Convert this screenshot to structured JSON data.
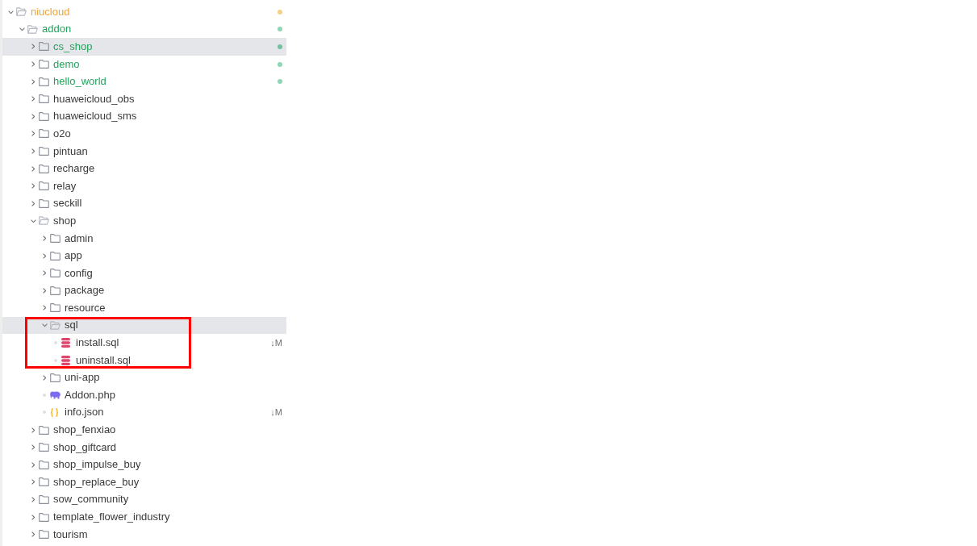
{
  "tree": [
    {
      "name": "niucloud",
      "kind": "folder",
      "expanded": true,
      "selected": false,
      "annotated": false,
      "modified": true,
      "untracked": false,
      "color": "#f5cf86",
      "children": [
        {
          "name": "addon",
          "kind": "folder",
          "expanded": true,
          "selected": false,
          "annotated": false,
          "modified": false,
          "untracked": true,
          "color": "#8fd6b5",
          "children": [
            {
              "name": "cs_shop",
              "kind": "folder",
              "expanded": false,
              "selected": true,
              "annotated": false,
              "modified": false,
              "untracked": true,
              "color": "#74c29d"
            },
            {
              "name": "demo",
              "kind": "folder",
              "expanded": false,
              "selected": false,
              "annotated": false,
              "modified": false,
              "untracked": true,
              "color": "#8fd6b5"
            },
            {
              "name": "hello_world",
              "kind": "folder",
              "expanded": false,
              "selected": false,
              "annotated": false,
              "modified": false,
              "untracked": true,
              "color": "#8fd6b5"
            },
            {
              "name": "huaweicloud_obs",
              "kind": "folder",
              "expanded": false,
              "selected": false,
              "annotated": false,
              "modified": false,
              "untracked": false
            },
            {
              "name": "huaweicloud_sms",
              "kind": "folder",
              "expanded": false,
              "selected": false,
              "annotated": false,
              "modified": false,
              "untracked": false
            },
            {
              "name": "o2o",
              "kind": "folder",
              "expanded": false,
              "selected": false,
              "annotated": false,
              "modified": false,
              "untracked": false
            },
            {
              "name": "pintuan",
              "kind": "folder",
              "expanded": false,
              "selected": false,
              "annotated": false,
              "modified": false,
              "untracked": false
            },
            {
              "name": "recharge",
              "kind": "folder",
              "expanded": false,
              "selected": false,
              "annotated": false,
              "modified": false,
              "untracked": false
            },
            {
              "name": "relay",
              "kind": "folder",
              "expanded": false,
              "selected": false,
              "annotated": false,
              "modified": false,
              "untracked": false
            },
            {
              "name": "seckill",
              "kind": "folder",
              "expanded": false,
              "selected": false,
              "annotated": false,
              "modified": false,
              "untracked": false
            },
            {
              "name": "shop",
              "kind": "folder",
              "expanded": true,
              "selected": false,
              "annotated": false,
              "modified": false,
              "untracked": false,
              "children": [
                {
                  "name": "admin",
                  "kind": "folder",
                  "expanded": false,
                  "selected": false,
                  "annotated": false,
                  "modified": false,
                  "untracked": false
                },
                {
                  "name": "app",
                  "kind": "folder",
                  "expanded": false,
                  "selected": false,
                  "annotated": false,
                  "modified": false,
                  "untracked": false
                },
                {
                  "name": "config",
                  "kind": "folder",
                  "expanded": false,
                  "selected": false,
                  "annotated": false,
                  "modified": false,
                  "untracked": false
                },
                {
                  "name": "package",
                  "kind": "folder",
                  "expanded": false,
                  "selected": false,
                  "annotated": false,
                  "modified": false,
                  "untracked": false
                },
                {
                  "name": "resource",
                  "kind": "folder",
                  "expanded": false,
                  "selected": false,
                  "annotated": false,
                  "modified": false,
                  "untracked": false
                },
                {
                  "name": "sql",
                  "kind": "folder",
                  "expanded": true,
                  "selected": true,
                  "annotated": true,
                  "modified": false,
                  "untracked": false,
                  "children": [
                    {
                      "name": "install.sql",
                      "kind": "database-file",
                      "selected": false,
                      "annotated": false,
                      "modified": false,
                      "untracked": false,
                      "badge": "↓M"
                    },
                    {
                      "name": "uninstall.sql",
                      "kind": "database-file",
                      "selected": false,
                      "annotated": false,
                      "modified": false,
                      "untracked": false
                    }
                  ]
                },
                {
                  "name": "uni-app",
                  "kind": "folder",
                  "expanded": false,
                  "selected": false,
                  "annotated": false,
                  "modified": false,
                  "untracked": false
                },
                {
                  "name": "Addon.php",
                  "kind": "php-file",
                  "selected": false,
                  "annotated": false,
                  "modified": false,
                  "untracked": false
                },
                {
                  "name": "info.json",
                  "kind": "json-file",
                  "selected": false,
                  "annotated": false,
                  "modified": false,
                  "untracked": false,
                  "badge": "↓M"
                }
              ]
            },
            {
              "name": "shop_fenxiao",
              "kind": "folder",
              "expanded": false,
              "selected": false,
              "annotated": false,
              "modified": false,
              "untracked": false
            },
            {
              "name": "shop_giftcard",
              "kind": "folder",
              "expanded": false,
              "selected": false,
              "annotated": false,
              "modified": false,
              "untracked": false
            },
            {
              "name": "shop_impulse_buy",
              "kind": "folder",
              "expanded": false,
              "selected": false,
              "annotated": false,
              "modified": false,
              "untracked": false
            },
            {
              "name": "shop_replace_buy",
              "kind": "folder",
              "expanded": false,
              "selected": false,
              "annotated": false,
              "modified": false,
              "untracked": false
            },
            {
              "name": "sow_community",
              "kind": "folder",
              "expanded": false,
              "selected": false,
              "annotated": false,
              "modified": false,
              "untracked": false
            },
            {
              "name": "template_flower_industry",
              "kind": "folder",
              "expanded": false,
              "selected": false,
              "annotated": false,
              "modified": false,
              "untracked": false
            },
            {
              "name": "tourism",
              "kind": "folder",
              "expanded": false,
              "selected": false,
              "annotated": false,
              "modified": false,
              "untracked": false
            }
          ]
        }
      ]
    }
  ]
}
